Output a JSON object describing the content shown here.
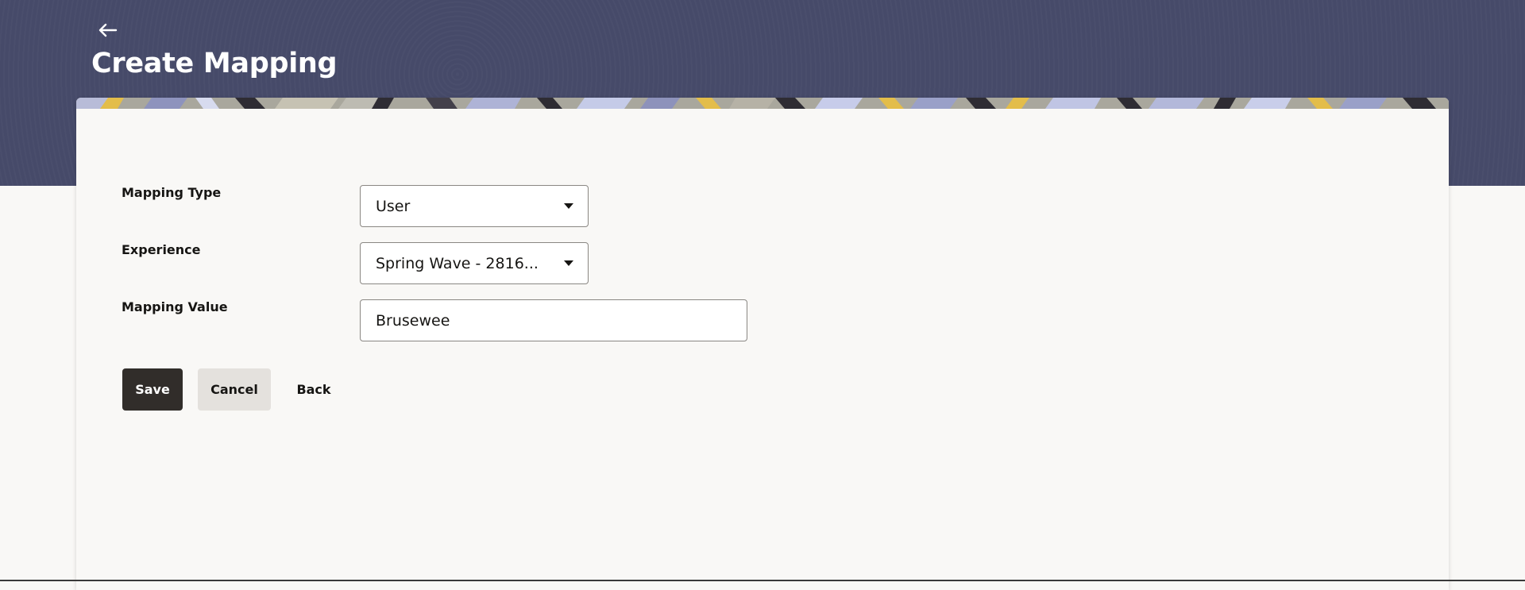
{
  "header": {
    "title": "Create Mapping",
    "back_icon": "arrow-left-icon"
  },
  "form": {
    "mapping_type": {
      "label": "Mapping Type",
      "value": "User"
    },
    "experience": {
      "label": "Experience",
      "value": "Spring Wave - 2816..."
    },
    "mapping_value": {
      "label": "Mapping Value",
      "value": "Brusewee"
    }
  },
  "actions": {
    "save_label": "Save",
    "cancel_label": "Cancel",
    "back_label": "Back"
  },
  "colors": {
    "header_bg": "#464a69",
    "primary_button": "#312d2a",
    "secondary_button": "#e4e1dd",
    "page_bg": "#f9f8f6"
  }
}
